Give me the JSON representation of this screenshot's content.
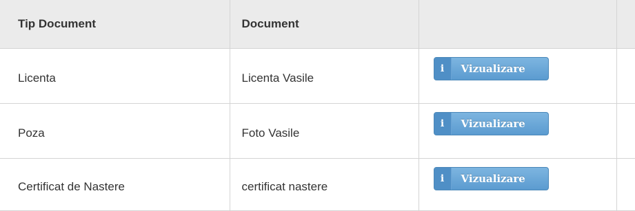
{
  "table": {
    "headers": [
      "Tip Document",
      "Document",
      "",
      ""
    ],
    "rows": [
      {
        "type": "Licenta",
        "document": "Licenta Vasile",
        "action_label": "Vizualizare"
      },
      {
        "type": "Poza",
        "document": "Foto Vasile",
        "action_label": "Vizualizare"
      },
      {
        "type": "Certificat de Nastere",
        "document": "certificat nastere",
        "action_label": "Vizualizare"
      }
    ],
    "action_icon": "info-icon",
    "action_icon_glyph": "i"
  },
  "colors": {
    "header_bg": "#ebebeb",
    "border": "#d4d4d4",
    "button_bg": "#6aa8da",
    "text": "#333333"
  }
}
